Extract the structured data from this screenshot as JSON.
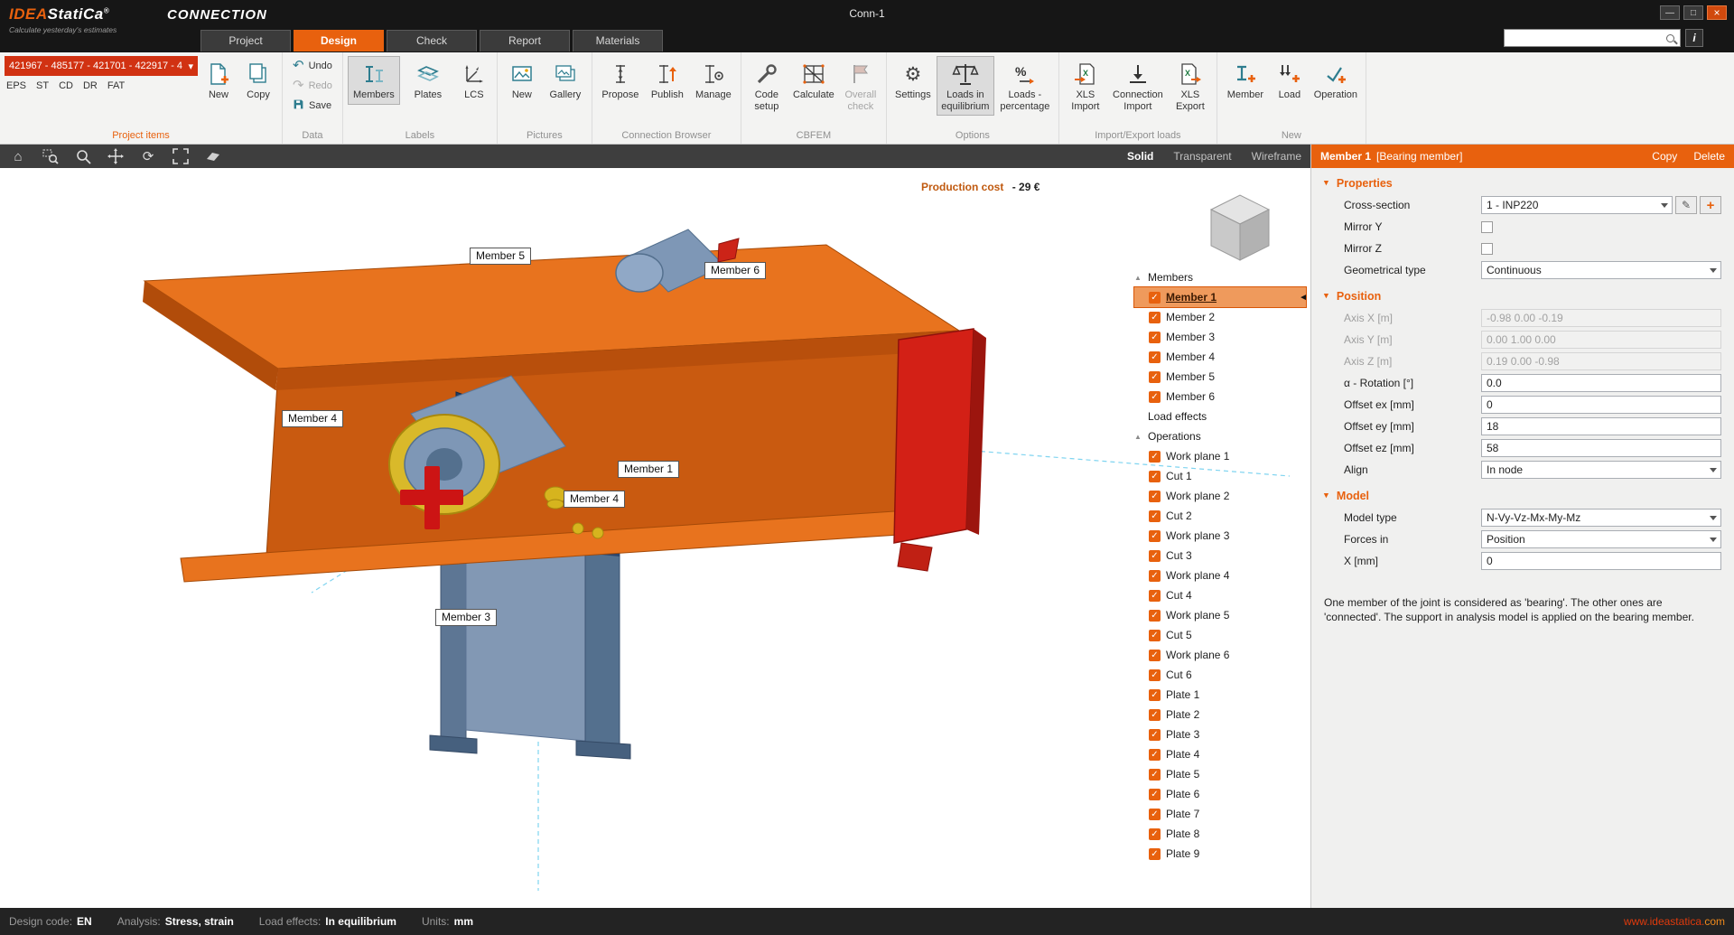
{
  "title_bar": {
    "logo_primary": "IDEA",
    "logo_secondary": "StatiCa",
    "logo_reg": "®",
    "tagline": "Calculate yesterday's estimates",
    "product": "CONNECTION",
    "window_title": "Conn-1"
  },
  "tabs": [
    {
      "label": "Project",
      "active": false
    },
    {
      "label": "Design",
      "active": true
    },
    {
      "label": "Check",
      "active": false
    },
    {
      "label": "Report",
      "active": false
    },
    {
      "label": "Materials",
      "active": false
    }
  ],
  "search": {
    "placeholder": ""
  },
  "ribbon": {
    "groups": {
      "project_items": {
        "label": "Project items",
        "dropdown_value": "421967 - 485177 - 421701 - 422917 - 4",
        "codes": [
          "EPS",
          "ST",
          "CD",
          "DR",
          "FAT"
        ],
        "new": "New",
        "copy": "Copy"
      },
      "data": {
        "label": "Data",
        "undo": "Undo",
        "redo": "Redo",
        "save": "Save"
      },
      "labels": {
        "label": "Labels",
        "members": "Members",
        "plates": "Plates",
        "lcs": "LCS"
      },
      "pictures": {
        "label": "Pictures",
        "new": "New",
        "gallery": "Gallery"
      },
      "connection_browser": {
        "label": "Connection Browser",
        "propose": "Propose",
        "publish": "Publish",
        "manage": "Manage"
      },
      "cbfem": {
        "label": "CBFEM",
        "code_setup": "Code setup",
        "calculate": "Calculate",
        "overall_check": "Overall check"
      },
      "options": {
        "label": "Options",
        "settings": "Settings",
        "loads_in_equilibrium": "Loads in equilibrium",
        "loads_percentage": "Loads - percentage"
      },
      "import_export": {
        "label": "Import/Export loads",
        "xls_import": "XLS Import",
        "connection_import": "Connection Import",
        "xls_export": "XLS Export"
      },
      "new": {
        "label": "New",
        "member": "Member",
        "load": "Load",
        "operation": "Operation"
      }
    }
  },
  "viewport": {
    "production_cost_label": "Production cost",
    "production_cost_value": "-  29 €",
    "modes": [
      {
        "label": "Solid",
        "active": true
      },
      {
        "label": "Transparent",
        "active": false
      },
      {
        "label": "Wireframe",
        "active": false
      }
    ],
    "member_labels": [
      {
        "text": "Member 5"
      },
      {
        "text": "Member 6"
      },
      {
        "text": "Member 4"
      },
      {
        "text": "Member 1"
      },
      {
        "text": "Member 4"
      },
      {
        "text": "Member 3"
      }
    ]
  },
  "tree": {
    "members_header": "Members",
    "members": [
      {
        "label": "Member 1",
        "selected": true
      },
      {
        "label": "Member 2",
        "selected": false
      },
      {
        "label": "Member 3",
        "selected": false
      },
      {
        "label": "Member 4",
        "selected": false
      },
      {
        "label": "Member 5",
        "selected": false
      },
      {
        "label": "Member 6",
        "selected": false
      }
    ],
    "load_effects_header": "Load effects",
    "operations_header": "Operations",
    "operations": [
      "Work plane 1",
      "Cut 1",
      "Work plane 2",
      "Cut 2",
      "Work plane 3",
      "Cut 3",
      "Work plane 4",
      "Cut 4",
      "Work plane 5",
      "Cut 5",
      "Work plane 6",
      "Cut 6",
      "Plate 1",
      "Plate 2",
      "Plate 3",
      "Plate 4",
      "Plate 5",
      "Plate 6",
      "Plate 7",
      "Plate 8",
      "Plate 9"
    ]
  },
  "panel": {
    "title": "Member 1",
    "subtitle": "[Bearing member]",
    "copy_label": "Copy",
    "delete_label": "Delete",
    "properties_header": "Properties",
    "cross_section_label": "Cross-section",
    "cross_section_value": "1 - INP220",
    "mirror_y_label": "Mirror Y",
    "mirror_z_label": "Mirror Z",
    "geometrical_type_label": "Geometrical type",
    "geometrical_type_value": "Continuous",
    "position_header": "Position",
    "axis_x_label": "Axis X [m]",
    "axis_x_value": "-0.98 0.00 -0.19",
    "axis_y_label": "Axis Y [m]",
    "axis_y_value": "0.00 1.00 0.00",
    "axis_z_label": "Axis Z [m]",
    "axis_z_value": "0.19 0.00 -0.98",
    "rotation_label": "α - Rotation [°]",
    "rotation_value": "0.0",
    "offset_ex_label": "Offset ex [mm]",
    "offset_ex_value": "0",
    "offset_ey_label": "Offset ey [mm]",
    "offset_ey_value": "18",
    "offset_ez_label": "Offset ez [mm]",
    "offset_ez_value": "58",
    "align_label": "Align",
    "align_value": "In node",
    "model_header": "Model",
    "model_type_label": "Model type",
    "model_type_value": "N-Vy-Vz-Mx-My-Mz",
    "forces_in_label": "Forces in",
    "forces_in_value": "Position",
    "x_label": "X [mm]",
    "x_value": "0",
    "help_text": "One member of the joint is considered as 'bearing'. The other ones are 'connected'. The support in analysis model is applied on the bearing member."
  },
  "status_bar": {
    "design_code_label": "Design code:",
    "design_code": "EN",
    "analysis_label": "Analysis:",
    "analysis": "Stress, strain",
    "load_effects_label": "Load effects:",
    "load_effects": "In equilibrium",
    "units_label": "Units:",
    "units": "mm",
    "website": "www.ideastatica.",
    "website_tld": "com"
  },
  "icons": {
    "check": "✓",
    "undo": "↶",
    "redo": "↷",
    "home": "⌂",
    "rotate": "⟳",
    "settings": "⚙",
    "minimize": "—",
    "maximize": "□",
    "close": "×",
    "info": "i",
    "pencil": "✎",
    "plus": "+",
    "dropdown": "▾",
    "tree_collapse": "▲",
    "selected_marker": "◄"
  },
  "colors": {
    "accent_orange": "#E8610E",
    "project_select_red": "#D13212",
    "beam_orange_top": "#E8731E",
    "beam_orange_front": "#C95A10",
    "end_plate_red": "#D32016",
    "steel_blue": "#7E97B6",
    "bolt_ring_yellow": "#D9B92A",
    "construction_line_cyan": "#7FD4F0",
    "statusbar_dark": "#232323"
  }
}
